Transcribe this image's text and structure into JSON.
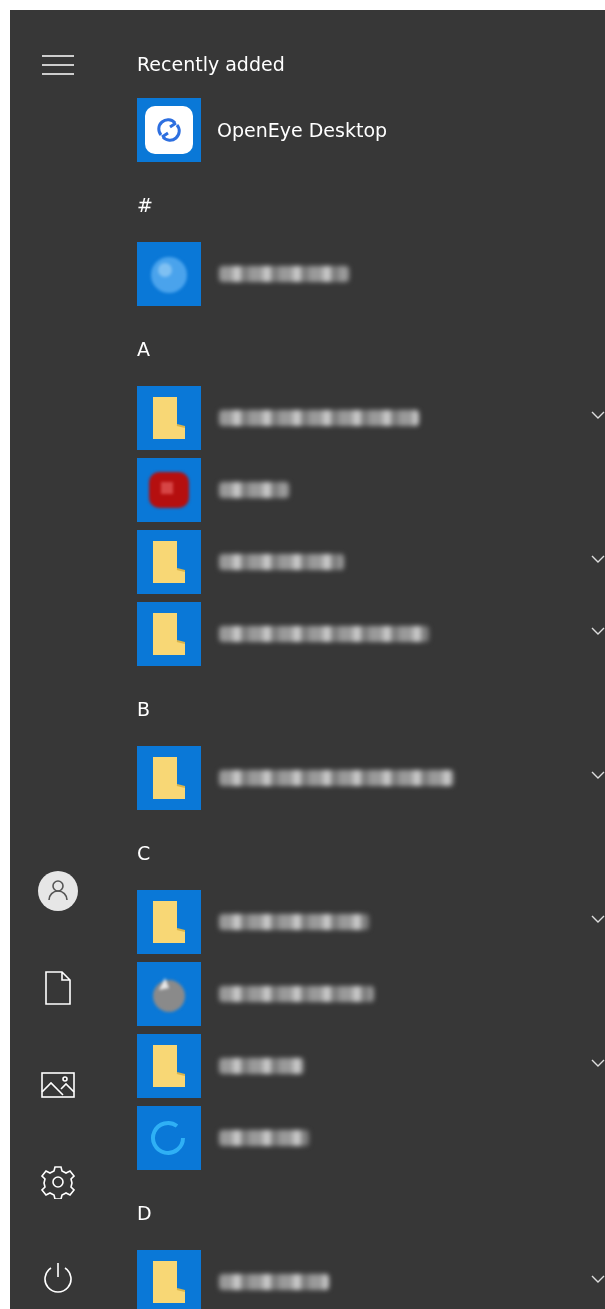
{
  "sections": [
    {
      "header": "Recently added",
      "apps": [
        {
          "kind": "openeye",
          "name": "OpenEye Desktop",
          "expandable": false
        }
      ]
    },
    {
      "header": "#",
      "apps": [
        {
          "kind": "globe",
          "expandable": false
        }
      ]
    },
    {
      "header": "A",
      "apps": [
        {
          "kind": "folder",
          "expandable": true
        },
        {
          "kind": "red",
          "expandable": false
        },
        {
          "kind": "folder",
          "expandable": true
        },
        {
          "kind": "folder",
          "expandable": true
        }
      ]
    },
    {
      "header": "B",
      "apps": [
        {
          "kind": "folder",
          "expandable": true
        }
      ]
    },
    {
      "header": "C",
      "apps": [
        {
          "kind": "folder",
          "expandable": true
        },
        {
          "kind": "grey",
          "expandable": false
        },
        {
          "kind": "folder",
          "expandable": true
        },
        {
          "kind": "ring",
          "expandable": false
        }
      ]
    },
    {
      "header": "D",
      "apps": [
        {
          "kind": "folder",
          "expandable": true
        }
      ]
    }
  ]
}
